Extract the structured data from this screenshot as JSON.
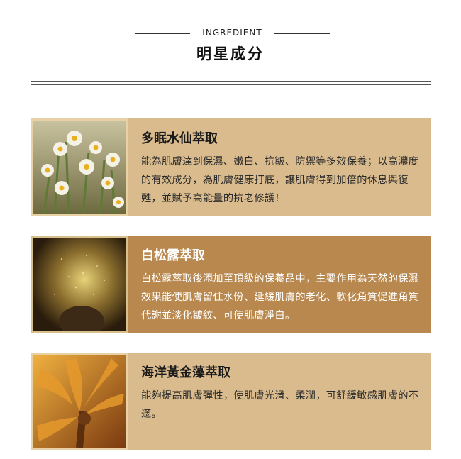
{
  "header": {
    "eyebrow": "INGREDIENT",
    "title": "明星成分"
  },
  "ingredients": [
    {
      "name": "多眠水仙萃取",
      "description": "能為肌膚達到保濕、嫩白、抗皺、防禦等多效保養；以高濃度的有效成分，為肌膚健康打底，讓肌膚得到加倍的休息與復甦，並賦予高能量的抗老修護！",
      "card_color": "#d9bb8d"
    },
    {
      "name": "白松露萃取",
      "description": "白松露萃取後添加至頂級的保養品中，主要作用為天然的保濕效果能使肌膚留住水份、延緩肌膚的老化、軟化角質促進角質代謝並淡化皺紋、可使肌膚淨白。",
      "card_color": "#b9884e"
    },
    {
      "name": "海洋黃金藻萃取",
      "description": "能夠提高肌膚彈性，使肌膚光滑、柔潤，可舒緩敏感肌膚的不適。",
      "card_color": "#d9bb8d"
    }
  ]
}
